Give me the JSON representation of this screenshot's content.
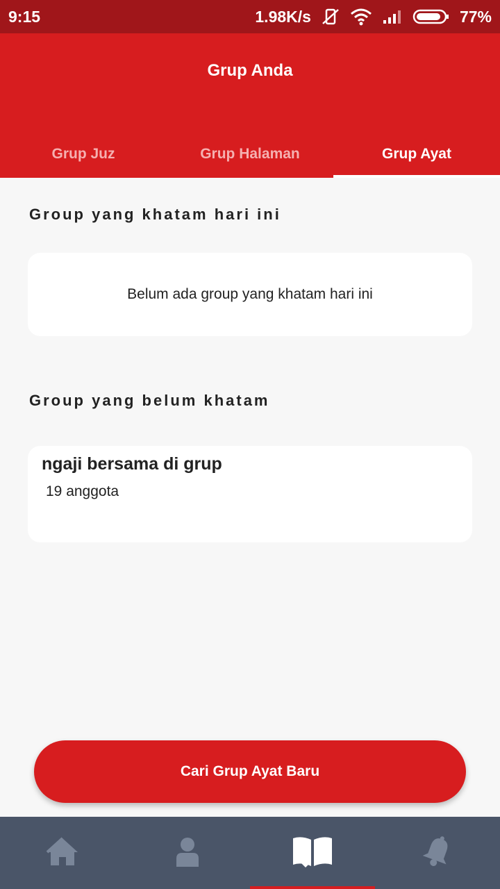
{
  "status_bar": {
    "time": "9:15",
    "network_speed": "1.98K/s",
    "battery": "77%"
  },
  "header": {
    "title": "Grup Anda"
  },
  "tabs": [
    {
      "label": "Grup Juz",
      "active": false
    },
    {
      "label": "Grup Halaman",
      "active": false
    },
    {
      "label": "Grup Ayat",
      "active": true
    }
  ],
  "sections": {
    "completed_title": "Group yang khatam hari ini",
    "completed_empty": "Belum ada group yang khatam hari ini",
    "pending_title": "Group yang belum khatam"
  },
  "groups": [
    {
      "name": "ngaji bersama di grup",
      "members": "19 anggota"
    }
  ],
  "cta": {
    "label": "Cari Grup Ayat Baru"
  },
  "bottom_nav": [
    {
      "icon": "home-icon",
      "active": false
    },
    {
      "icon": "user-icon",
      "active": false
    },
    {
      "icon": "book-icon",
      "active": true
    },
    {
      "icon": "bell-icon",
      "active": false
    }
  ],
  "colors": {
    "primary": "#d71d1f",
    "status_bar": "#a0161a",
    "nav_bg": "#4a5568",
    "nav_icon": "#7a8699"
  }
}
